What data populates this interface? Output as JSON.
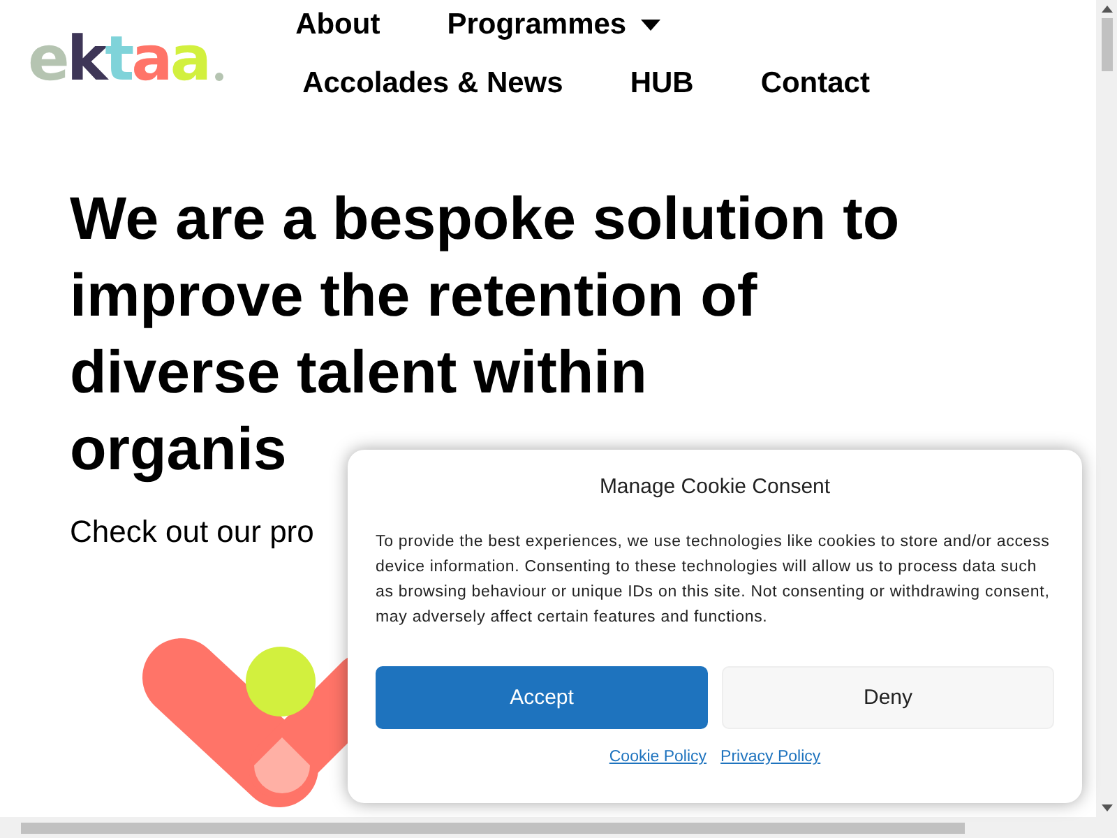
{
  "logo": {
    "letters": [
      {
        "char": "e",
        "color": "#b5c4b1"
      },
      {
        "char": "k",
        "color": "#3e3657"
      },
      {
        "char": "t",
        "color": "#7fd3d9"
      },
      {
        "char": "a",
        "color": "#ff7468"
      },
      {
        "char": "a",
        "color": "#d2f03e"
      }
    ]
  },
  "nav": {
    "items": [
      {
        "label": "About",
        "dropdown": false
      },
      {
        "label": "Programmes",
        "dropdown": true
      },
      {
        "label": "Accolades & News",
        "dropdown": false
      },
      {
        "label": "HUB",
        "dropdown": false
      },
      {
        "label": "Contact",
        "dropdown": false
      }
    ]
  },
  "hero": {
    "heading_lines": [
      "We are a bespoke solution to",
      "improve the retention of",
      "diverse talent within",
      "organis"
    ],
    "subtitle": "Check out our pro"
  },
  "cookie_dialog": {
    "title": "Manage Cookie Consent",
    "message": "To provide the best experiences, we use technologies like cookies to store and/or access device information. Consenting to these technologies will allow us to process data such as browsing behaviour or unique IDs on this site. Not consenting or withdrawing consent, may adversely affect certain features and functions.",
    "buttons": [
      {
        "label": "Accept",
        "kind": "primary"
      },
      {
        "label": "Deny",
        "kind": "secondary"
      }
    ],
    "links": [
      "Cookie Policy",
      "Privacy Policy"
    ]
  }
}
